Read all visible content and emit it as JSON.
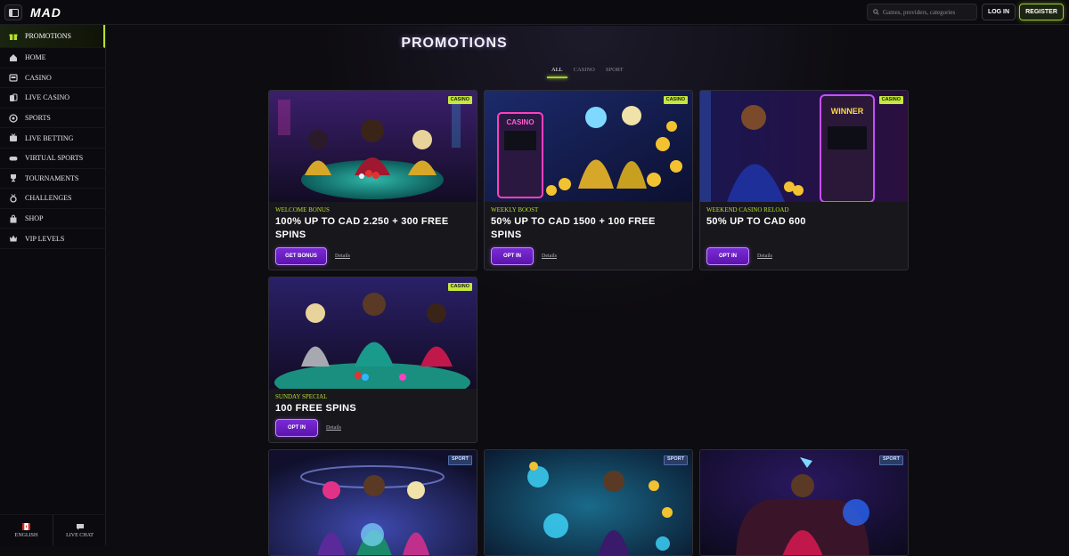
{
  "topbar": {
    "logo": "MAD",
    "search_placeholder": "Games, providers, categories",
    "login_label": "LOG IN",
    "register_label": "REGISTER"
  },
  "sidebar": {
    "items": [
      {
        "label": "PROMOTIONS",
        "icon": "gift-icon",
        "active": true
      },
      {
        "label": "HOME",
        "icon": "home-icon"
      },
      {
        "label": "CASINO",
        "icon": "slot-machine-icon"
      },
      {
        "label": "LIVE CASINO",
        "icon": "cards-icon"
      },
      {
        "label": "SPORTS",
        "icon": "soccer-ball-icon"
      },
      {
        "label": "LIVE BETTING",
        "icon": "tv-icon"
      },
      {
        "label": "VIRTUAL SPORTS",
        "icon": "gamepad-icon"
      },
      {
        "label": "TOURNAMENTS",
        "icon": "trophy-icon"
      },
      {
        "label": "CHALLENGES",
        "icon": "medal-icon"
      },
      {
        "label": "SHOP",
        "icon": "shopping-bag-icon"
      },
      {
        "label": "VIP LEVELS",
        "icon": "crown-icon"
      }
    ],
    "footer": {
      "language_label": "ENGLISH",
      "chat_label": "LIVE CHAT"
    }
  },
  "main": {
    "title": "PROMOTIONS",
    "filters": [
      {
        "label": "ALL",
        "active": true
      },
      {
        "label": "CASINO"
      },
      {
        "label": "SPORT"
      }
    ],
    "cards": [
      {
        "badge": "CASINO",
        "subtitle": "WELCOME BONUS",
        "title": "100% UP TO CAD 2.250 + 300 FREE SPINS",
        "cta": "GET BONUS",
        "details": "Details"
      },
      {
        "badge": "CASINO",
        "subtitle": "WEEKLY BOOST",
        "title": "50% UP TO CAD 1500 + 100 FREE SPINS",
        "cta": "OPT IN",
        "details": "Details"
      },
      {
        "badge": "CASINO",
        "subtitle": "WEEKEND CASINO RELOAD",
        "title": "50% UP TO CAD 600",
        "cta": "OPT IN",
        "details": "Details"
      },
      {
        "badge": "CASINO",
        "subtitle": "SUNDAY SPECIAL",
        "title": "100 FREE SPINS",
        "cta": "OPT IN",
        "details": "Details"
      },
      {
        "badge": "SPORT"
      },
      {
        "badge": "SPORT"
      },
      {
        "badge": "SPORT"
      }
    ],
    "art_labels": {
      "slot_sign": "CASINO",
      "winner_sign": "WINNER"
    }
  },
  "colors": {
    "accent_green": "#b6e02d",
    "cta_purple": "#6a1fc4",
    "background": "#0d0c10"
  }
}
